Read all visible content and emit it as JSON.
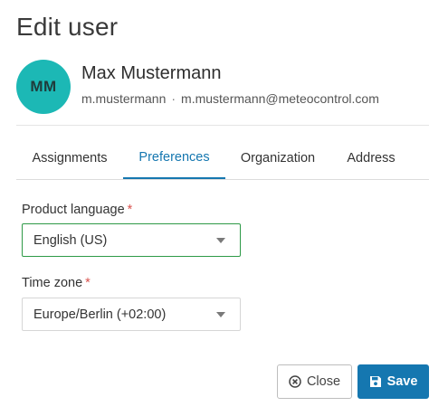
{
  "dialog": {
    "title": "Edit user"
  },
  "user": {
    "initials": "MM",
    "name": "Max Mustermann",
    "username": "m.mustermann",
    "separator": "·",
    "email": "m.mustermann@meteocontrol.com"
  },
  "tabs": [
    {
      "label": "Assignments",
      "active": false
    },
    {
      "label": "Preferences",
      "active": true
    },
    {
      "label": "Organization",
      "active": false
    },
    {
      "label": "Address",
      "active": false
    }
  ],
  "fields": {
    "product_language": {
      "label": "Product language",
      "required_mark": "*",
      "value": "English (US)"
    },
    "time_zone": {
      "label": "Time zone",
      "required_mark": "*",
      "value": "Europe/Berlin (+02:00)"
    }
  },
  "actions": {
    "close_label": "Close",
    "save_label": "Save"
  },
  "colors": {
    "accent": "#1577b0",
    "avatar": "#1cb8b5",
    "focus_border": "#2e9a47",
    "required": "#d9534f"
  },
  "icons": {
    "close": "close-circle-icon",
    "save": "floppy-disk-icon",
    "dropdown": "caret-down-icon"
  }
}
